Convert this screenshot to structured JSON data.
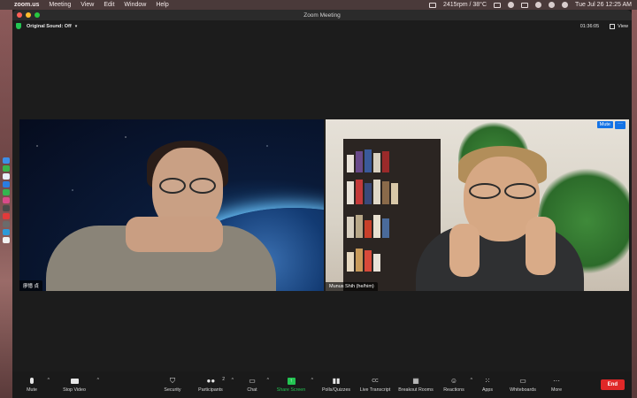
{
  "menubar": {
    "app_name": "zoom.us",
    "items": [
      "Meeting",
      "View",
      "Edit",
      "Window",
      "Help"
    ],
    "status": "2415rpm / 38°C",
    "datetime": "Tue Jul 26  12:25 AM"
  },
  "window": {
    "title": "Zoom Meeting"
  },
  "topbar": {
    "original_sound": "Original Sound: Off",
    "timer": "01:36:05",
    "view_label": "View"
  },
  "tiles": [
    {
      "name": "廖憶 貞"
    },
    {
      "name": "Munus Shih (he/him)",
      "mute_label": "Mute",
      "more_label": "···"
    }
  ],
  "toolbar": {
    "items": [
      {
        "label": "Mute",
        "icon": "microphone-icon"
      },
      {
        "label": "Stop Video",
        "icon": "video-camera-icon"
      },
      {
        "label": "Security",
        "icon": "shield-icon"
      },
      {
        "label": "Participants",
        "icon": "participants-icon",
        "count": "2"
      },
      {
        "label": "Chat",
        "icon": "chat-icon"
      },
      {
        "label": "Share Screen",
        "icon": "share-screen-icon"
      },
      {
        "label": "Polls/Quizzes",
        "icon": "polls-icon"
      },
      {
        "label": "Live Transcript",
        "icon": "cc-icon"
      },
      {
        "label": "Breakout Rooms",
        "icon": "breakout-icon"
      },
      {
        "label": "Reactions",
        "icon": "reactions-icon"
      },
      {
        "label": "Apps",
        "icon": "apps-icon"
      },
      {
        "label": "Whiteboards",
        "icon": "whiteboard-icon"
      },
      {
        "label": "More",
        "icon": "more-icon"
      }
    ],
    "end_label": "End"
  },
  "colors": {
    "share_green": "#23c552",
    "end_red": "#e02828",
    "badge_blue": "#1473e6"
  }
}
